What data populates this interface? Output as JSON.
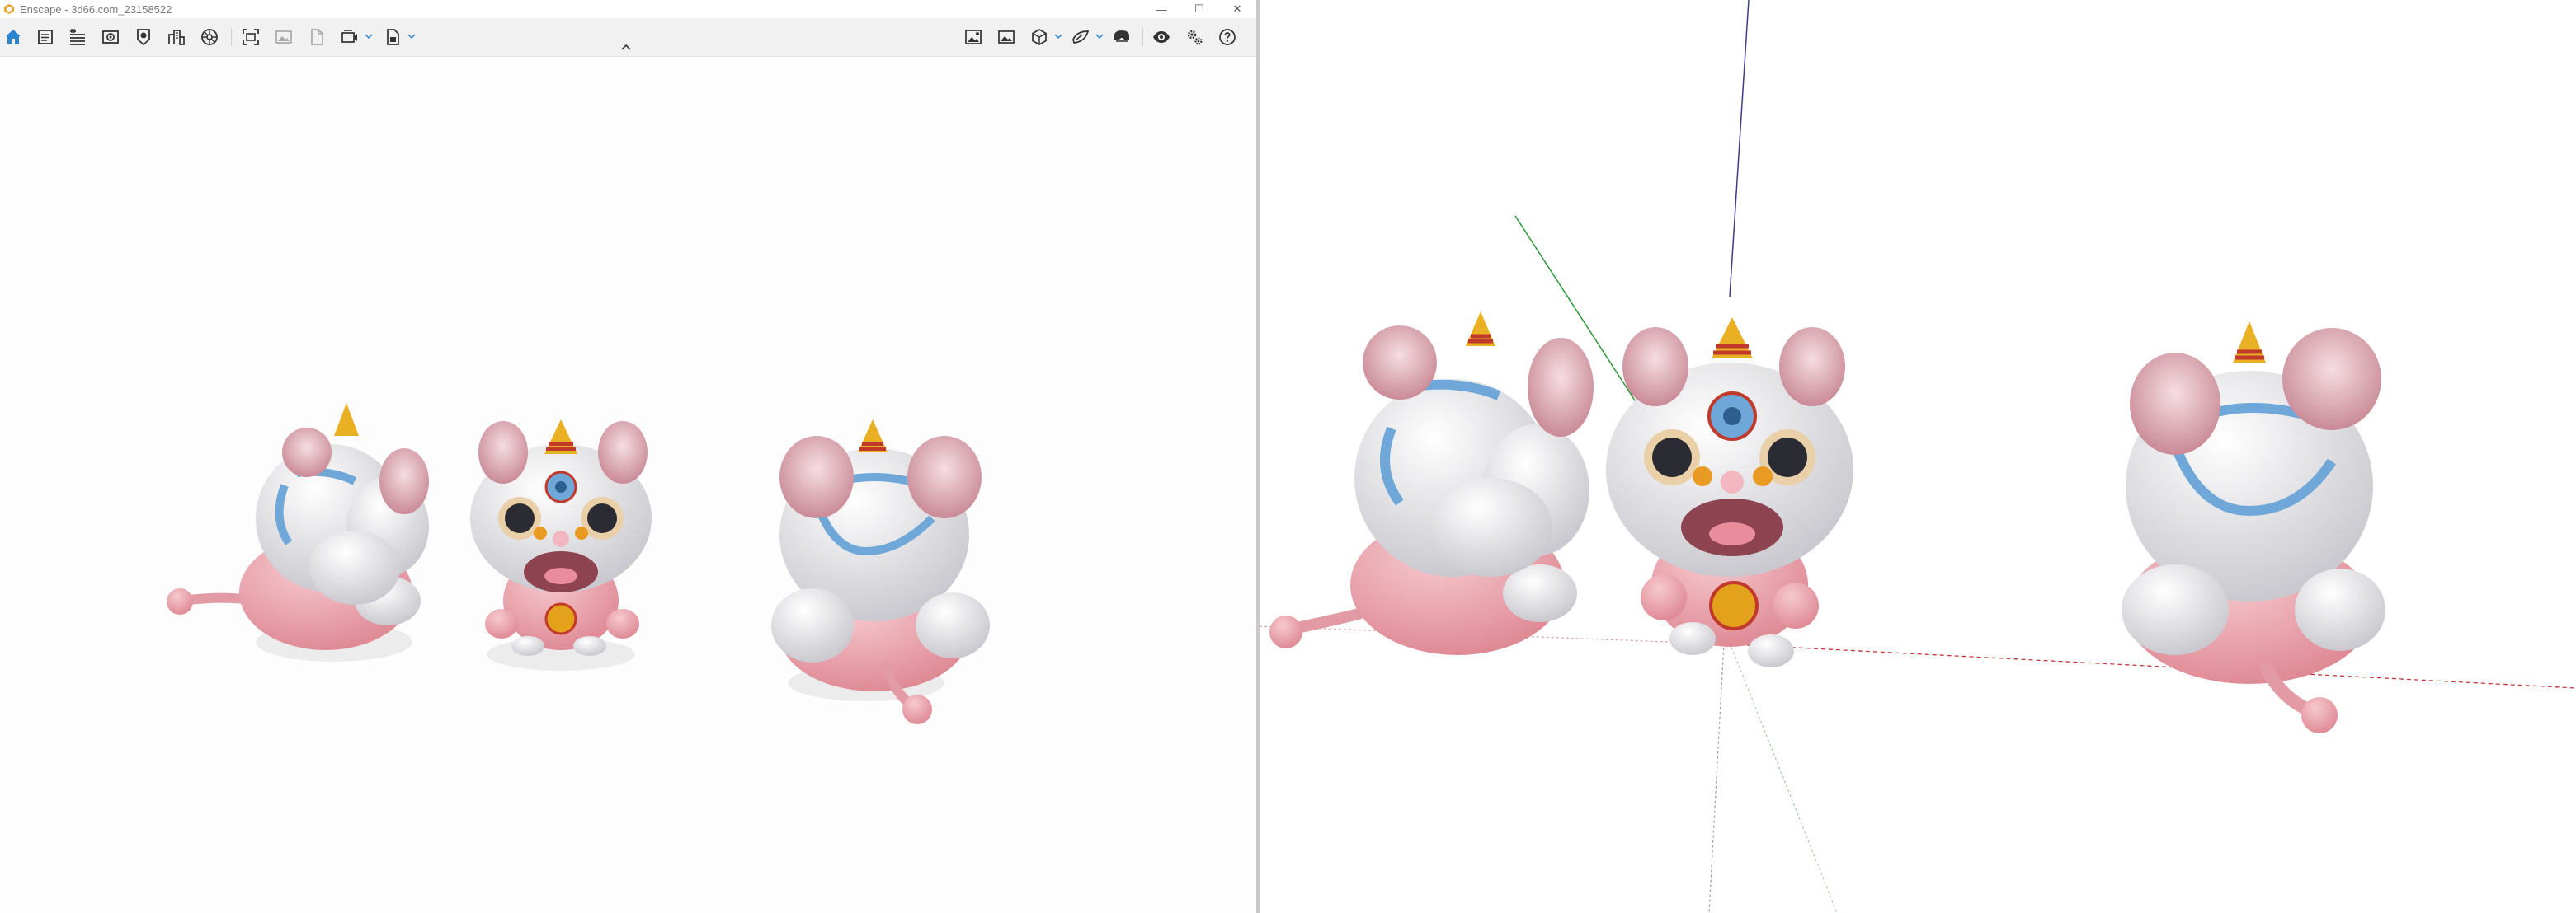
{
  "window": {
    "title": "Enscape - 3d66.com_23158522"
  },
  "toolbar": {
    "left_items": [
      {
        "icon": "home-icon",
        "active": true
      },
      {
        "icon": "documents-icon"
      },
      {
        "icon": "properties-list-icon"
      },
      {
        "icon": "camera-view-icon"
      },
      {
        "icon": "asset-library-icon"
      },
      {
        "icon": "buildings-icon"
      },
      {
        "icon": "material-editor-icon"
      },
      {
        "icon": "screenshot-icon"
      },
      {
        "icon": "render-image-icon"
      },
      {
        "icon": "export-file-icon"
      },
      {
        "icon": "video-editor-icon"
      },
      {
        "icon": "batch-render-icon"
      }
    ],
    "right_items": [
      {
        "icon": "capture-image-icon"
      },
      {
        "icon": "gallery-icon"
      },
      {
        "icon": "panorama-cube-icon"
      },
      {
        "icon": "visual-settings-icon"
      },
      {
        "icon": "vr-headset-icon"
      },
      {
        "icon": "eye-icon"
      },
      {
        "icon": "settings-gears-icon"
      },
      {
        "icon": "help-icon"
      }
    ],
    "accent_color": "#2a84d2"
  },
  "window_controls": {
    "minimize": "—",
    "maximize": "☐",
    "close": "✕"
  }
}
